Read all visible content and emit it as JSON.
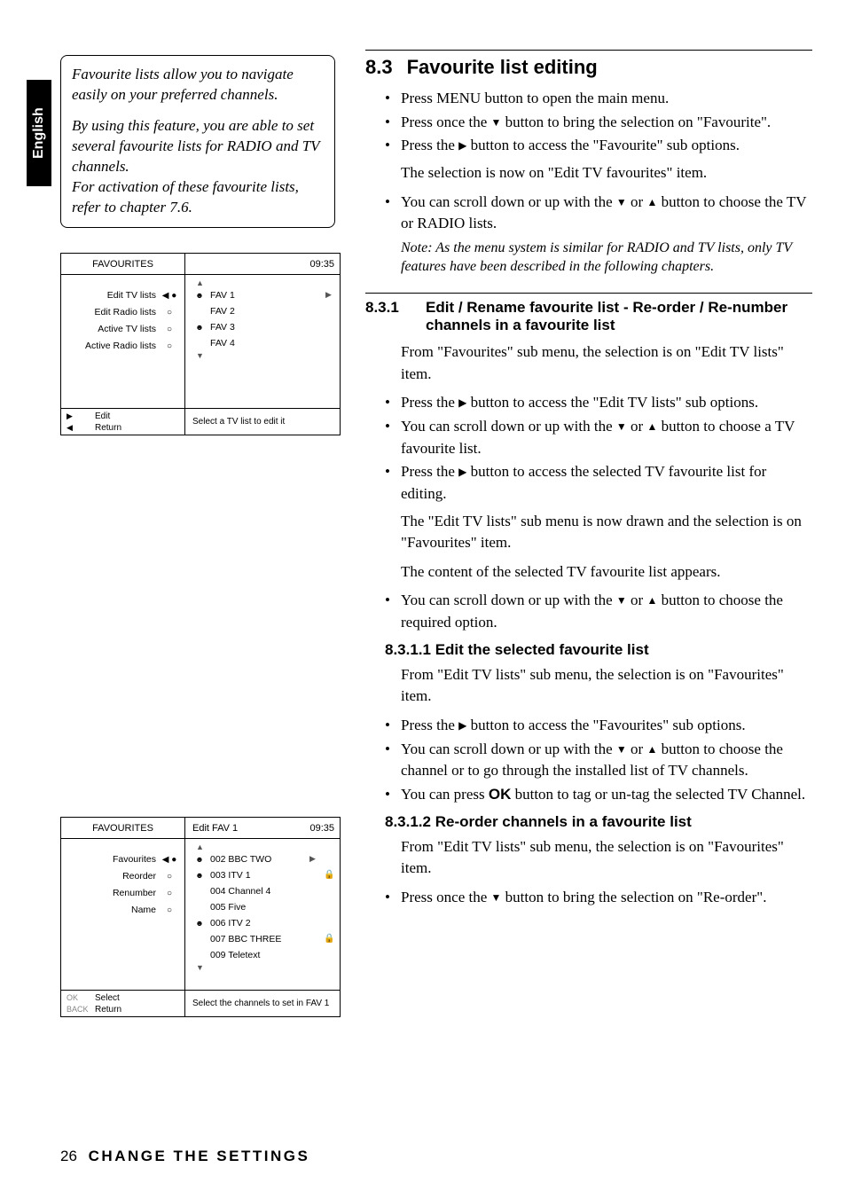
{
  "lang_tab": "English",
  "intro": {
    "p1": "Favourite lists allow you to navigate easily on your preferred channels.",
    "p2": "By using this feature, you are able to set several favourite lists for RADIO and TV channels.",
    "p3": "For activation of these favourite lists, refer to chapter 7.6."
  },
  "osd1": {
    "title": "FAVOURITES",
    "time": "09:35",
    "left_items": [
      {
        "label": "Edit TV lists",
        "mark": "◀ ●"
      },
      {
        "label": "Edit Radio lists",
        "mark": "○"
      },
      {
        "label": "Active TV lists",
        "mark": "○"
      },
      {
        "label": "Active Radio lists",
        "mark": "○"
      }
    ],
    "right_items": [
      {
        "icon": "☻",
        "label": "FAV 1",
        "rarr": "▶"
      },
      {
        "icon": "",
        "label": "FAV 2",
        "rarr": ""
      },
      {
        "icon": "☻",
        "label": "FAV 3",
        "rarr": ""
      },
      {
        "icon": "",
        "label": "FAV 4",
        "rarr": ""
      }
    ],
    "footer": {
      "l1k": "▶",
      "l1v": "Edit",
      "l2k": "◀",
      "l2v": "Return",
      "right": "Select a TV list to edit it"
    }
  },
  "osd2": {
    "title": "FAVOURITES",
    "mid": "Edit FAV 1",
    "time": "09:35",
    "left_items": [
      {
        "label": "Favourites",
        "mark": "◀ ●"
      },
      {
        "label": "Reorder",
        "mark": "○"
      },
      {
        "label": "Renumber",
        "mark": "○"
      },
      {
        "label": "Name",
        "mark": "○"
      }
    ],
    "right_items": [
      {
        "icon": "☻",
        "label": "002 BBC TWO",
        "rarr": "▶",
        "lock": ""
      },
      {
        "icon": "☻",
        "label": "003 ITV 1",
        "rarr": "",
        "lock": "🔒"
      },
      {
        "icon": "",
        "label": "004 Channel 4",
        "rarr": "",
        "lock": ""
      },
      {
        "icon": "",
        "label": "005 Five",
        "rarr": "",
        "lock": ""
      },
      {
        "icon": "☻",
        "label": "006 ITV 2",
        "rarr": "",
        "lock": ""
      },
      {
        "icon": "",
        "label": "007 BBC THREE",
        "rarr": "",
        "lock": "🔒"
      },
      {
        "icon": "",
        "label": "009 Teletext",
        "rarr": "",
        "lock": ""
      }
    ],
    "footer": {
      "l1k": "OK",
      "l1v": "Select",
      "l2k": "BACK",
      "l2v": "Return",
      "right": "Select the channels to set in FAV 1"
    }
  },
  "section83": {
    "num": "8.3",
    "title": "Favourite list editing",
    "b1": "Press MENU button to open the main menu.",
    "b2a": "Press once the ",
    "b2b": " button to bring the selection on \"Favourite\".",
    "b3a": "Press the ",
    "b3b": " button to access the \"Favourite\" sub options.",
    "p1": "The selection is now on \"Edit TV favourites\" item.",
    "b4a": "You can scroll down or up with the ",
    "b4b": " or ",
    "b4c": " button to choose the TV or RADIO lists.",
    "note": "Note: As the menu system is similar for RADIO and TV lists, only TV features have been described in the following chapters."
  },
  "section831": {
    "num": "8.3.1",
    "title": "Edit / Rename favourite list - Re-order / Re-number channels in a favourite list",
    "p1": "From \"Favourites\" sub menu, the selection is on \"Edit TV lists\" item.",
    "b1a": "Press the ",
    "b1b": " button to access the \"Edit TV lists\" sub options.",
    "b2a": "You can scroll down or up with the ",
    "b2b": " or ",
    "b2c": " button to choose a TV favourite list.",
    "b3a": "Press the ",
    "b3b": " button to access the selected TV favourite list for editing.",
    "p2": "The \"Edit TV lists\" sub menu is now drawn and the selection is on \"Favourites\" item.",
    "p3": "The content of the selected TV favourite list appears.",
    "b4a": "You can scroll down or up with the ",
    "b4b": " or ",
    "b4c": " button to choose the required option."
  },
  "section8311": {
    "title": "8.3.1.1 Edit the selected favourite list",
    "p1": "From \"Edit TV lists\" sub menu, the selection is on \"Favourites\" item.",
    "b1a": "Press the ",
    "b1b": " button to access the \"Favourites\" sub options.",
    "b2a": "You can scroll down or up with the ",
    "b2b": " or ",
    "b2c": " button to choose the channel or to go through the installed list of TV channels.",
    "b3a": "You can press ",
    "b3ok": "OK",
    "b3b": " button to tag or un-tag the selected TV Channel."
  },
  "section8312": {
    "title": "8.3.1.2 Re-order channels in a favourite list",
    "p1": "From \"Edit TV lists\" sub menu, the selection is on \"Favourites\" item.",
    "b1a": "Press once the ",
    "b1b": " button to bring the selection on \"Re-order\"."
  },
  "footer": {
    "page": "26",
    "title": "CHANGE THE SETTINGS"
  },
  "glyph": {
    "down": "▼",
    "up": "▲",
    "right": "▶"
  }
}
